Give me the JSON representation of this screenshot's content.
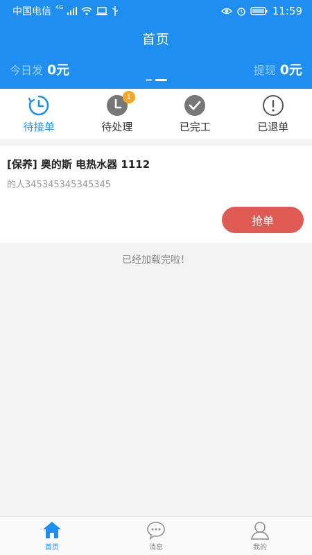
{
  "status_bar": {
    "carrier": "中国电信",
    "network": "4G",
    "time": "11:59"
  },
  "header": {
    "title": "首页",
    "stats": [
      {
        "label": "今日发",
        "value": "0元"
      },
      {
        "label": "提现",
        "value": "0元"
      }
    ],
    "pager_dots": 2,
    "pager_active": 1
  },
  "tabs": [
    {
      "label": "待接单",
      "icon": "clock-icon",
      "active": true
    },
    {
      "label": "待处理",
      "icon": "pending-clock-icon",
      "badge": "1"
    },
    {
      "label": "已完工",
      "icon": "check-circle-icon"
    },
    {
      "label": "已退单",
      "icon": "exclamation-circle-icon"
    }
  ],
  "order": {
    "title": "[保养] 奥的斯 电热水器 1112",
    "subtitle": "的人345345345345345",
    "button_label": "抢单"
  },
  "list_footer": "已经加载完啦！",
  "bottom_nav": [
    {
      "label": "首页",
      "icon": "home-icon",
      "active": true
    },
    {
      "label": "消息",
      "icon": "message-icon"
    },
    {
      "label": "我的",
      "icon": "user-icon"
    }
  ],
  "colors": {
    "primary": "#1e8ff1",
    "accent": "#e05a54",
    "badge": "#f5a623"
  }
}
